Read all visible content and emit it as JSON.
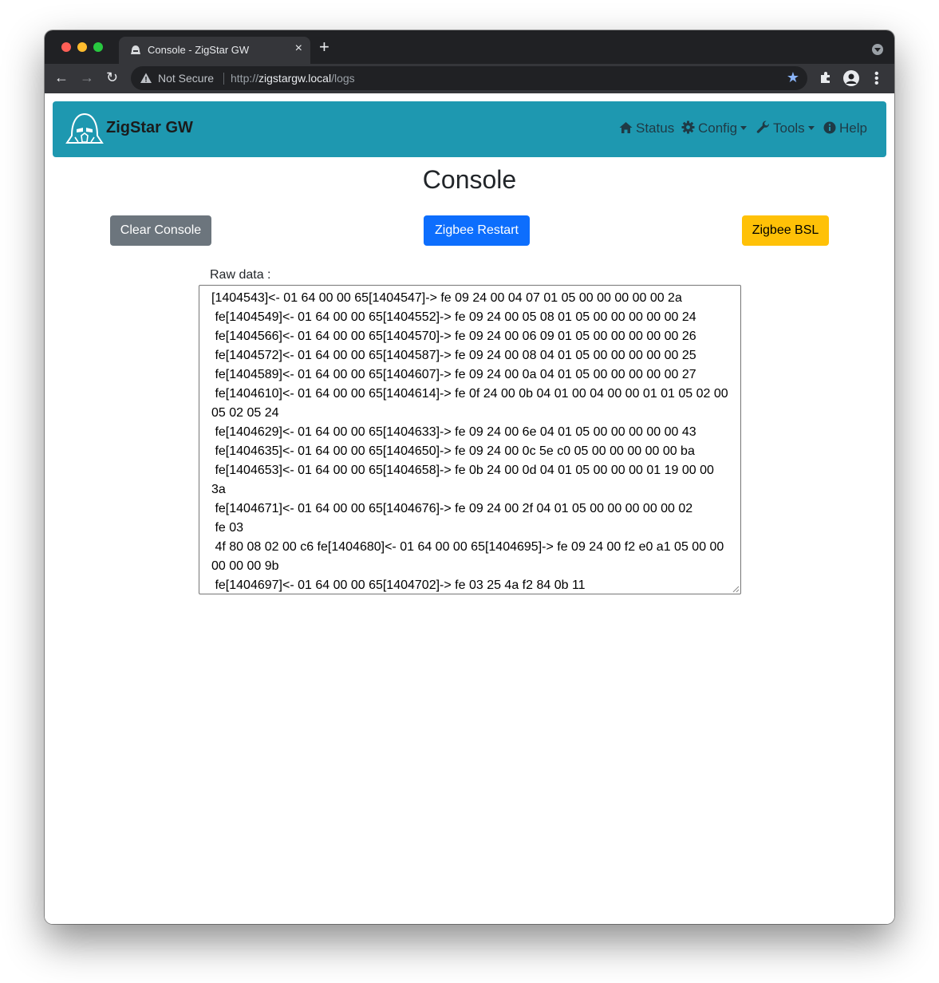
{
  "browser": {
    "tab_title": "Console - ZigStar GW",
    "tab_close": "×",
    "new_tab": "+",
    "security_label": "Not Secure",
    "url_scheme": "http://",
    "url_host": "zigstargw.local",
    "url_path": "/logs",
    "bookmark_star": "★"
  },
  "navbar": {
    "brand": "ZigStar GW",
    "links": [
      {
        "label": "Status",
        "icon": "home-icon"
      },
      {
        "label": "Config",
        "icon": "gear-icon"
      },
      {
        "label": "Tools",
        "icon": "wrench-icon"
      },
      {
        "label": "Help",
        "icon": "info-circle-icon"
      }
    ],
    "brand_color": "#1e98b0"
  },
  "main": {
    "title": "Console",
    "buttons": {
      "clear": "Clear Console",
      "restart": "Zigbee Restart",
      "bsl": "Zigbee BSL"
    },
    "raw_label": "Raw data :",
    "log": "[1404543]<- 01 64 00 00 65[1404547]-> fe 09 24 00 04 07 01 05 00 00 00 00 00 2a\n fe[1404549]<- 01 64 00 00 65[1404552]-> fe 09 24 00 05 08 01 05 00 00 00 00 00 24\n fe[1404566]<- 01 64 00 00 65[1404570]-> fe 09 24 00 06 09 01 05 00 00 00 00 00 26\n fe[1404572]<- 01 64 00 00 65[1404587]-> fe 09 24 00 08 04 01 05 00 00 00 00 00 25\n fe[1404589]<- 01 64 00 00 65[1404607]-> fe 09 24 00 0a 04 01 05 00 00 00 00 00 27\n fe[1404610]<- 01 64 00 00 65[1404614]-> fe 0f 24 00 0b 04 01 00 04 00 00 01 01 05 02 00 05 02 05 24\n fe[1404629]<- 01 64 00 00 65[1404633]-> fe 09 24 00 6e 04 01 05 00 00 00 00 00 43\n fe[1404635]<- 01 64 00 00 65[1404650]-> fe 09 24 00 0c 5e c0 05 00 00 00 00 00 ba\n fe[1404653]<- 01 64 00 00 65[1404658]-> fe 0b 24 00 0d 04 01 05 00 00 00 01 19 00 00 3a\n fe[1404671]<- 01 64 00 00 65[1404676]-> fe 09 24 00 2f 04 01 05 00 00 00 00 00 02\n fe 03\n 4f 80 08 02 00 c6 fe[1404680]<- 01 64 00 00 65[1404695]-> fe 09 24 00 f2 e0 a1 05 00 00 00 00 00 9b\n fe[1404697]<- 01 64 00 00 65[1404702]-> fe 03 25 4a f2 84 0b 11"
  }
}
